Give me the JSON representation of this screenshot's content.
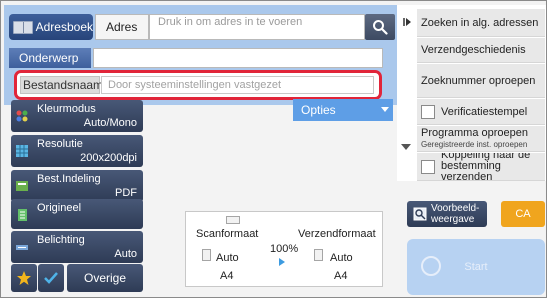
{
  "header": {
    "address_book": "Adresboek",
    "address_label": "Adres",
    "address_placeholder": "Druk in om adres in te voeren"
  },
  "fields": {
    "subject_label": "Onderwerp",
    "subject_value": "",
    "filename_label": "Bestandsnaam",
    "filename_placeholder": "Door systeeminstellingen vastgezet"
  },
  "options_label": "Opties",
  "right_menu": {
    "items": [
      "Zoeken in alg. adressen",
      "Verzendgeschiedenis",
      "Zoeknummer oproepen",
      "Verificatiestempel",
      "Programma oproepen",
      "Koppeling naar de bestemming verzenden"
    ],
    "program_sub": "Geregistreerde inst. oproepen"
  },
  "settings": [
    {
      "label": "Kleurmodus",
      "value": "Auto/Mono",
      "icon": "color-mode-icon"
    },
    {
      "label": "Resolutie",
      "value": "200x200dpi",
      "icon": "resolution-icon"
    },
    {
      "label": "Best.Indeling",
      "value": "PDF",
      "icon": "file-format-icon"
    },
    {
      "label": "Origineel",
      "value": "",
      "icon": "original-icon"
    },
    {
      "label": "Belichting",
      "value": "Auto",
      "icon": "exposure-icon"
    }
  ],
  "bottom": {
    "others": "Overige"
  },
  "preview_panel": {
    "scan_label": "Scanformaat",
    "send_label": "Verzendformaat",
    "ratio": "100%",
    "scan_auto": "Auto",
    "scan_size": "A4",
    "send_auto": "Auto",
    "send_size": "A4"
  },
  "buttons": {
    "preview": "Voorbeeld-weergave",
    "ca": "CA",
    "start": "Start"
  },
  "colors": {
    "highlight": "#e1253a",
    "panel_blue": "#aac8ec",
    "ca_orange": "#f0a51e"
  }
}
